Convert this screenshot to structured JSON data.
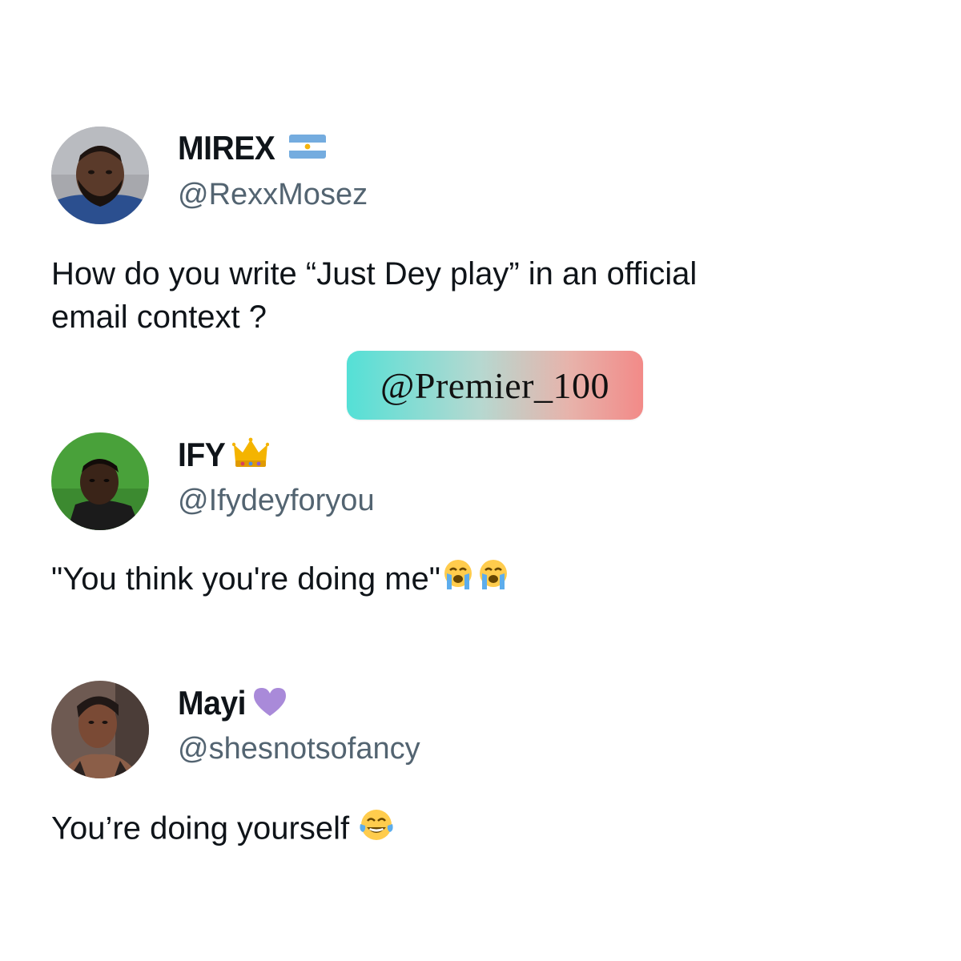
{
  "watermark": "@Premier_100",
  "tweets": [
    {
      "name": "MIREX",
      "handle": "@RexxMosez",
      "badge": "argentina-flag-icon",
      "text_lines": [
        "How do you write “Just Dey play” in an official",
        "email context ?"
      ]
    },
    {
      "name": "IFY",
      "handle": "@Ifydeyforyou",
      "badge": "crown-icon",
      "text": "\"You think you're doing me\"",
      "trailing_emoji": [
        "loudly-crying-face-icon",
        "loudly-crying-face-icon"
      ]
    },
    {
      "name": "Mayi",
      "handle": "@shesnotsofancy",
      "badge": "purple-heart-icon",
      "text": "You’re doing yourself ",
      "trailing_emoji": [
        "tears-of-joy-face-icon"
      ]
    }
  ],
  "colors": {
    "text": "#0f1419",
    "handle": "#536471",
    "heart": "#a98ad9",
    "crown": "#f4b400"
  }
}
